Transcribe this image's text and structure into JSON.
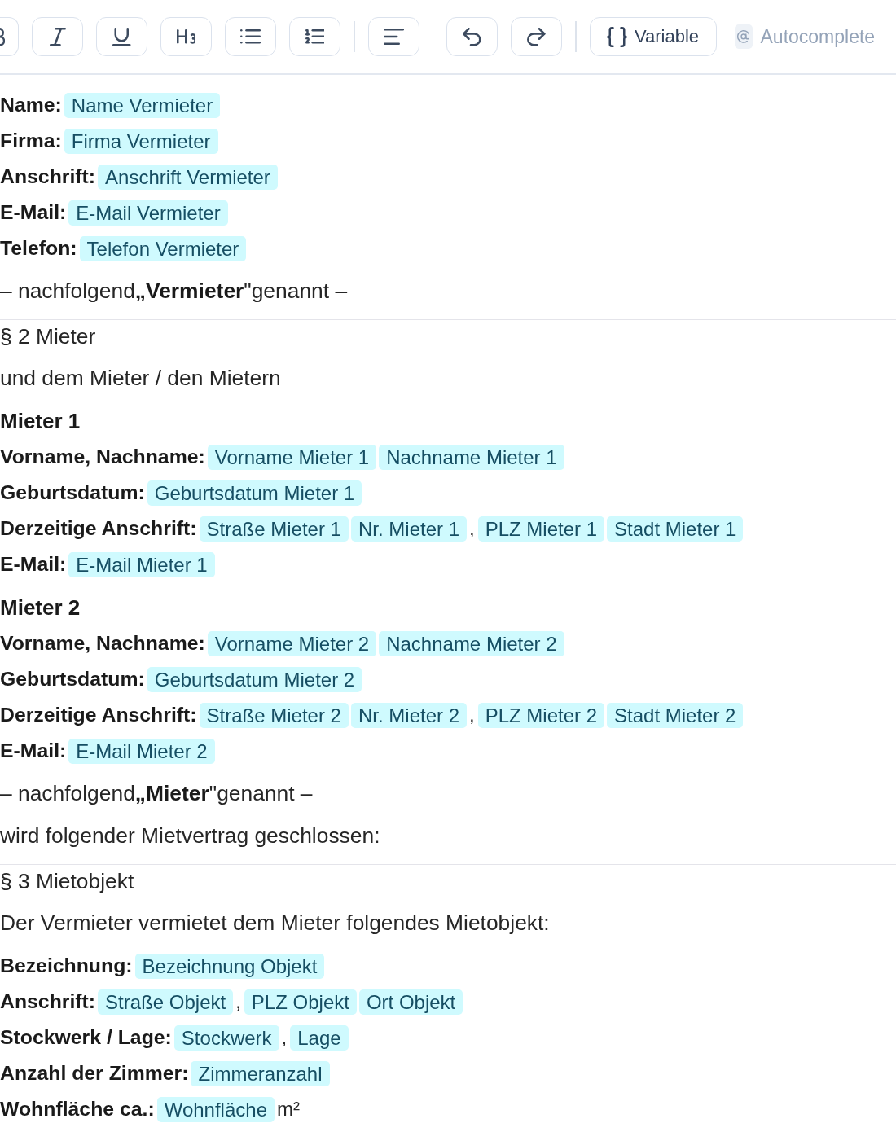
{
  "toolbar": {
    "items": [
      {
        "kind": "bold"
      },
      {
        "kind": "italic"
      },
      {
        "kind": "underline"
      },
      {
        "kind": "heading"
      },
      {
        "kind": "bullet-list"
      },
      {
        "kind": "numbered-list"
      },
      {
        "kind": "separator"
      },
      {
        "kind": "align-left"
      },
      {
        "kind": "separator"
      },
      {
        "kind": "undo"
      },
      {
        "kind": "redo"
      },
      {
        "kind": "separator"
      },
      {
        "kind": "variable",
        "label": "Variable"
      },
      {
        "kind": "autocomplete",
        "label": "Autocomplete",
        "on": false
      }
    ]
  },
  "document": {
    "blocks": [
      {
        "kind": "fields",
        "lines": [
          {
            "label": "Name:",
            "parts": [
              {
                "kind": "chip",
                "text": "Name Vermieter"
              }
            ]
          },
          {
            "label": "Firma:",
            "parts": [
              {
                "kind": "chip",
                "text": "Firma Vermieter"
              }
            ]
          },
          {
            "label": "Anschrift:",
            "parts": [
              {
                "kind": "chip",
                "text": "Anschrift Vermieter"
              }
            ]
          },
          {
            "label": "E-Mail:",
            "parts": [
              {
                "kind": "chip",
                "text": "E-Mail Vermieter"
              }
            ]
          },
          {
            "label": "Telefon:",
            "parts": [
              {
                "kind": "chip",
                "text": "Telefon Vermieter"
              }
            ]
          }
        ]
      },
      {
        "kind": "paragraph",
        "text": "– nachfolgend**„Vermieter**\"genannt –"
      },
      {
        "kind": "section",
        "title": "§ 2 Mieter"
      },
      {
        "kind": "paragraph",
        "text": "und dem Mieter / den Mietern"
      },
      {
        "kind": "fields",
        "title": "Mieter 1",
        "lines": [
          {
            "label": "Vorname, Nachname:",
            "parts": [
              {
                "kind": "chip",
                "text": "Vorname Mieter 1"
              },
              {
                "kind": "chip",
                "text": "Nachname Mieter 1"
              }
            ]
          },
          {
            "label": "Geburtsdatum:",
            "parts": [
              {
                "kind": "chip",
                "text": "Geburtsdatum Mieter 1"
              }
            ]
          },
          {
            "label": "Derzeitige Anschrift:",
            "parts": [
              {
                "kind": "chip",
                "text": "Straße Mieter 1"
              },
              {
                "kind": "chip",
                "text": "Nr. Mieter 1"
              },
              {
                "kind": "text",
                "text": ","
              },
              {
                "kind": "chip",
                "text": "PLZ Mieter 1"
              },
              {
                "kind": "chip",
                "text": "Stadt Mieter 1"
              }
            ]
          },
          {
            "label": "E-Mail:",
            "parts": [
              {
                "kind": "chip",
                "text": "E-Mail Mieter 1"
              }
            ]
          }
        ]
      },
      {
        "kind": "fields",
        "title": "Mieter 2",
        "lines": [
          {
            "label": "Vorname, Nachname:",
            "parts": [
              {
                "kind": "chip",
                "text": "Vorname Mieter 2"
              },
              {
                "kind": "chip",
                "text": "Nachname Mieter 2"
              }
            ]
          },
          {
            "label": "Geburtsdatum:",
            "parts": [
              {
                "kind": "chip",
                "text": "Geburtsdatum Mieter 2"
              }
            ]
          },
          {
            "label": "Derzeitige Anschrift:",
            "parts": [
              {
                "kind": "chip",
                "text": "Straße Mieter 2"
              },
              {
                "kind": "chip",
                "text": "Nr. Mieter 2"
              },
              {
                "kind": "text",
                "text": ","
              },
              {
                "kind": "chip",
                "text": "PLZ Mieter 2"
              },
              {
                "kind": "chip",
                "text": "Stadt Mieter 2"
              }
            ]
          },
          {
            "label": "E-Mail:",
            "parts": [
              {
                "kind": "chip",
                "text": "E-Mail Mieter 2"
              }
            ]
          }
        ]
      },
      {
        "kind": "paragraph",
        "text": "– nachfolgend**„Mieter**\"genannt –"
      },
      {
        "kind": "paragraph",
        "text": "wird folgender Mietvertrag geschlossen:"
      },
      {
        "kind": "section",
        "title": "§ 3 Mietobjekt"
      },
      {
        "kind": "paragraph",
        "text": "Der Vermieter vermietet dem Mieter folgendes Mietobjekt:"
      },
      {
        "kind": "fields",
        "lines": [
          {
            "label": "Bezeichnung:",
            "parts": [
              {
                "kind": "chip",
                "text": "Bezeichnung Objekt"
              }
            ]
          },
          {
            "label": "Anschrift:",
            "parts": [
              {
                "kind": "chip",
                "text": "Straße Objekt"
              },
              {
                "kind": "text",
                "text": ","
              },
              {
                "kind": "chip",
                "text": "PLZ Objekt"
              },
              {
                "kind": "chip",
                "text": "Ort Objekt"
              }
            ]
          },
          {
            "label": "Stockwerk / Lage:",
            "parts": [
              {
                "kind": "chip",
                "text": "Stockwerk"
              },
              {
                "kind": "text",
                "text": ","
              },
              {
                "kind": "chip",
                "text": "Lage"
              }
            ]
          },
          {
            "label": "Anzahl der Zimmer:",
            "parts": [
              {
                "kind": "chip",
                "text": "Zimmeranzahl"
              }
            ]
          },
          {
            "label": "Wohnfläche ca.:",
            "parts": [
              {
                "kind": "chip",
                "text": "Wohnfläche"
              },
              {
                "kind": "text",
                "text": "m²"
              }
            ]
          }
        ]
      }
    ]
  }
}
